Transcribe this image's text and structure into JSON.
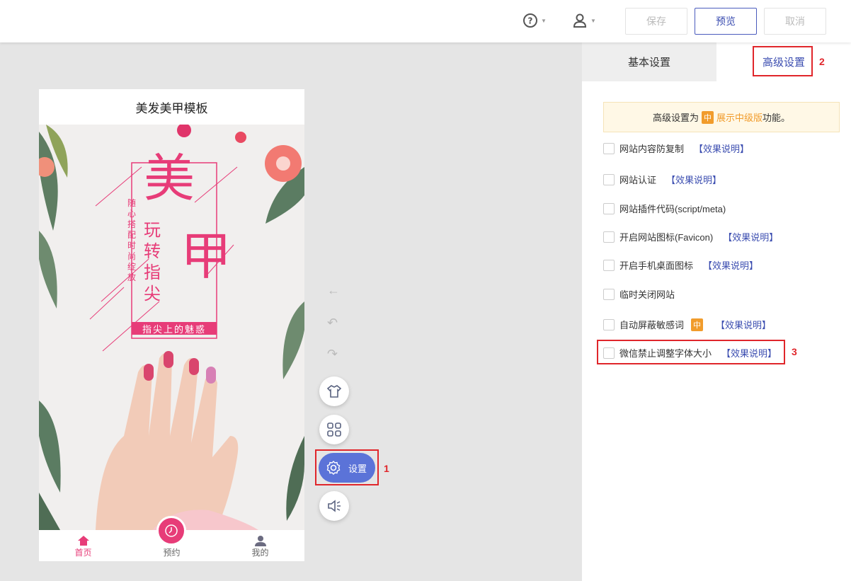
{
  "toolbar": {
    "help_icon": "help-circle-icon",
    "user_icon": "user-icon",
    "save_label": "保存",
    "preview_label": "预览",
    "cancel_label": "取消"
  },
  "phone": {
    "title": "美发美甲模板",
    "poster": {
      "big_char_1": "美",
      "big_char_2": "甲",
      "vertical_main": [
        "玩",
        "转",
        "指",
        "尖"
      ],
      "vertical_side": "随心搭配时尚绽放",
      "banner": "指尖上的魅惑"
    },
    "nav": [
      {
        "label": "首页",
        "icon": "home-icon"
      },
      {
        "label": "预约",
        "icon": "clock-icon"
      },
      {
        "label": "我的",
        "icon": "user-icon"
      }
    ]
  },
  "tools": {
    "settings_label": "设置"
  },
  "annotations": {
    "n1": "1",
    "n2": "2",
    "n3": "3"
  },
  "panel": {
    "tabs": [
      "基本设置",
      "高级设置"
    ],
    "notice": {
      "prefix": "高级设置为",
      "badge": "中",
      "link": "展示中级版",
      "suffix": "功能。"
    },
    "options": [
      {
        "label": "网站内容防复制",
        "link": "【效果说明】"
      },
      {
        "label": "网站认证",
        "link": "【效果说明】"
      },
      {
        "label": "网站插件代码(script/meta)",
        "link": ""
      },
      {
        "label": "开启网站图标(Favicon)",
        "link": "【效果说明】"
      },
      {
        "label": "开启手机桌面图标",
        "link": "【效果说明】"
      },
      {
        "label": "临时关闭网站",
        "link": ""
      },
      {
        "label": "自动屏蔽敏感词",
        "badge": "中",
        "link": "【效果说明】"
      },
      {
        "label": "微信禁止调整字体大小",
        "link": "【效果说明】"
      }
    ]
  },
  "colors": {
    "accent": "#3b4db0",
    "brand_pink": "#e73c78",
    "tool_active": "#5b73d8",
    "highlight_red": "#e0262b"
  }
}
